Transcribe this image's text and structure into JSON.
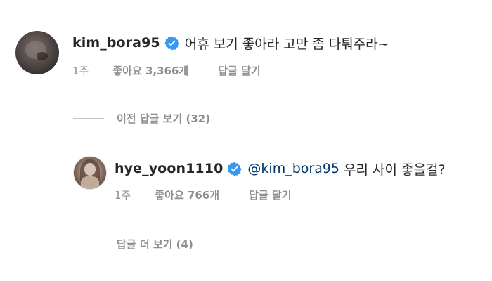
{
  "comment": {
    "username": "kim_bora95",
    "text": "어휴 보기 좋아라 고만 좀 다퉈주라~",
    "time": "1주",
    "likes": "좋아요 3,366개",
    "reply_label": "답글 달기"
  },
  "view_previous_replies": "이전 답글 보기 (32)",
  "reply": {
    "username": "hye_yoon1110",
    "mention": "@kim_bora95",
    "text": "우리 사이 좋을걸?",
    "time": "1주",
    "likes": "좋아요 766개",
    "reply_label": "답글 달기"
  },
  "view_more_replies": "답글 더 보기 (4)",
  "colors": {
    "verified_badge": "#3897f0",
    "mention": "#00376b",
    "meta_text": "#8e8e8e",
    "primary_text": "#262626"
  },
  "icons": {
    "verified": "verified-badge-icon"
  }
}
